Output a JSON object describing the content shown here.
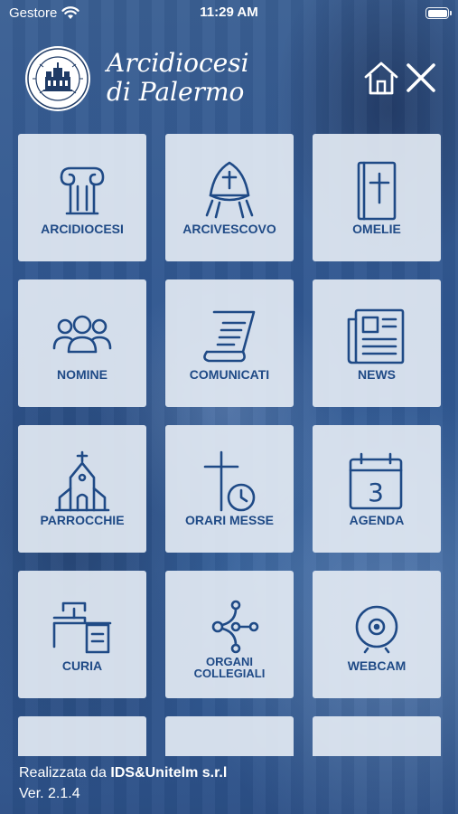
{
  "status_bar": {
    "carrier": "Gestore",
    "time": "11:29 AM"
  },
  "header": {
    "title_line1": "Arcidiocesi",
    "title_line2": "di Palermo"
  },
  "menu": [
    {
      "label": "ARCIDIOCESI",
      "icon": "column-icon"
    },
    {
      "label": "ARCIVESCOVO",
      "icon": "mitre-icon"
    },
    {
      "label": "OMELIE",
      "icon": "bible-icon"
    },
    {
      "label": "NOMINE",
      "icon": "people-icon"
    },
    {
      "label": "COMUNICATI",
      "icon": "scroll-icon"
    },
    {
      "label": "NEWS",
      "icon": "newspaper-icon"
    },
    {
      "label": "PARROCCHIE",
      "icon": "church-icon"
    },
    {
      "label": "ORARI MESSE",
      "icon": "cross-clock-icon"
    },
    {
      "label": "AGENDA",
      "icon": "calendar-icon"
    },
    {
      "label": "CURIA",
      "icon": "desk-icon"
    },
    {
      "label_line1": "ORGANI",
      "label_line2": "COLLEGIALI",
      "icon": "network-icon"
    },
    {
      "label": "WEBCAM",
      "icon": "webcam-icon"
    }
  ],
  "calendar_day": "3",
  "footer": {
    "credit_prefix": "Realizzata da ",
    "credit_company": "IDS&Unitelm s.r.l",
    "version": "Ver. 2.1.4"
  },
  "colors": {
    "accent": "#1f4a86",
    "tile": "#e1e8f2",
    "background": "#2d5389"
  }
}
